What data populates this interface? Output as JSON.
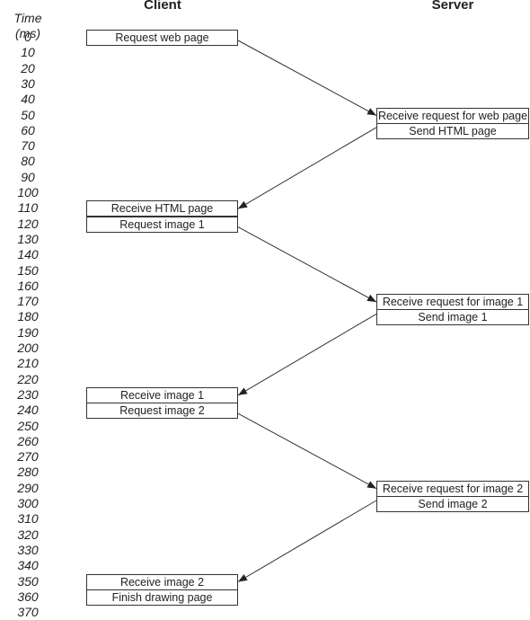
{
  "headers": {
    "client": "Client",
    "server": "Server"
  },
  "time_axis": {
    "label": "Time (ms)",
    "ticks": [
      0,
      10,
      20,
      30,
      40,
      50,
      60,
      70,
      80,
      90,
      100,
      110,
      120,
      130,
      140,
      150,
      160,
      170,
      180,
      190,
      200,
      210,
      220,
      230,
      240,
      250,
      260,
      270,
      280,
      290,
      300,
      310,
      320,
      330,
      340,
      350,
      360,
      370
    ]
  },
  "events": [
    {
      "side": "client",
      "time": 0,
      "label": "Request web page"
    },
    {
      "side": "server",
      "time": 50,
      "label": "Receive request for web page"
    },
    {
      "side": "server",
      "time": 60,
      "label": "Send HTML page"
    },
    {
      "side": "client",
      "time": 110,
      "label": "Receive HTML page"
    },
    {
      "side": "client",
      "time": 120,
      "label": "Request image 1"
    },
    {
      "side": "server",
      "time": 170,
      "label": "Receive request for image 1"
    },
    {
      "side": "server",
      "time": 180,
      "label": "Send image 1"
    },
    {
      "side": "client",
      "time": 230,
      "label": "Receive image 1"
    },
    {
      "side": "client",
      "time": 240,
      "label": "Request image 2"
    },
    {
      "side": "server",
      "time": 290,
      "label": "Receive request for image 2"
    },
    {
      "side": "server",
      "time": 300,
      "label": "Send image 2"
    },
    {
      "side": "client",
      "time": 350,
      "label": "Receive image 2"
    },
    {
      "side": "client",
      "time": 360,
      "label": "Finish drawing page"
    }
  ],
  "messages": [
    {
      "from_time": 0,
      "to_time": 50,
      "direction": "client-to-server"
    },
    {
      "from_time": 60,
      "to_time": 110,
      "direction": "server-to-client"
    },
    {
      "from_time": 120,
      "to_time": 170,
      "direction": "client-to-server"
    },
    {
      "from_time": 180,
      "to_time": 230,
      "direction": "server-to-client"
    },
    {
      "from_time": 240,
      "to_time": 290,
      "direction": "client-to-server"
    },
    {
      "from_time": 300,
      "to_time": 350,
      "direction": "server-to-client"
    }
  ]
}
